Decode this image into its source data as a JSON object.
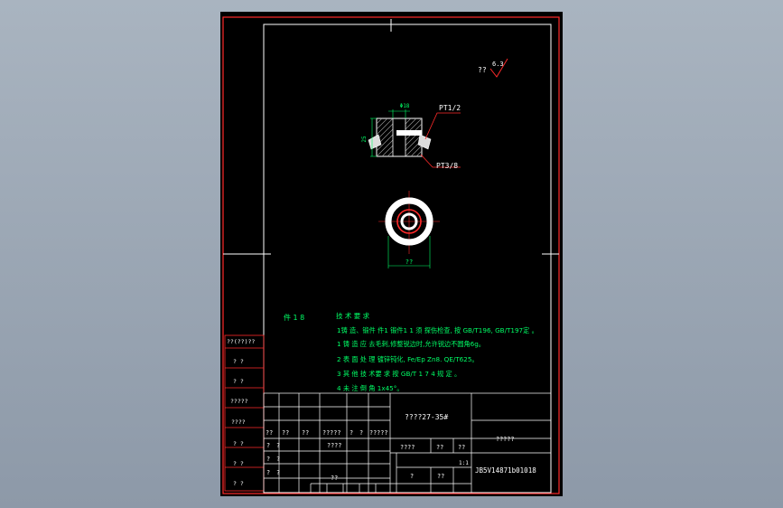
{
  "drawing": {
    "roughness_prefix": "??",
    "roughness_value": "6.3",
    "section_view": {
      "dim_top": "Φ18",
      "dim_height": "25",
      "thread_top": "PT1/2",
      "thread_bottom": "PT3/8"
    },
    "plan_view": {
      "dim_bottom": "??"
    },
    "scale_note": "件 1 8",
    "notes": {
      "title": "技 术 要 求",
      "lines": [
        "1铸 造、锻件 件1 锻件1 1 须 探伤检查, 按 GB/T196, GB/T197定 。",
        "1 铸 造 应 去毛刺,修整锐边时,允许锐边不圆角6g。",
        "2 表 面 处 理  镀锌钝化, Fe/Ep Zn8. QE/T625。",
        "3 其 他 技 术要 求 按 GB/T 1 7 4 规 定 。",
        "4 未 注 倒 角 1x45°。"
      ]
    }
  },
  "title_block": {
    "part_name": "????27-35#",
    "company": "?????",
    "drawing_no": "JB5V14871b01018",
    "material": "????",
    "small_a": "??",
    "small_b": "??",
    "row_r1": [
      "??",
      "??",
      "??",
      "?????",
      "?",
      "?",
      "?????"
    ],
    "row_r2": [
      "?",
      "?",
      "????"
    ],
    "row_r3": [
      "?",
      "?"
    ],
    "row_r4": [
      "?",
      "?",
      "??"
    ],
    "weight_cells": [
      "?",
      "?",
      "?"
    ],
    "sheet_cells": [
      "?",
      "??"
    ],
    "scale_cell": "1:1"
  },
  "side_block": {
    "labels": [
      "??(??)??",
      "?   ?",
      "?   ?",
      "?????",
      "????",
      "?   ?",
      "?   ?",
      "?   ?"
    ]
  }
}
